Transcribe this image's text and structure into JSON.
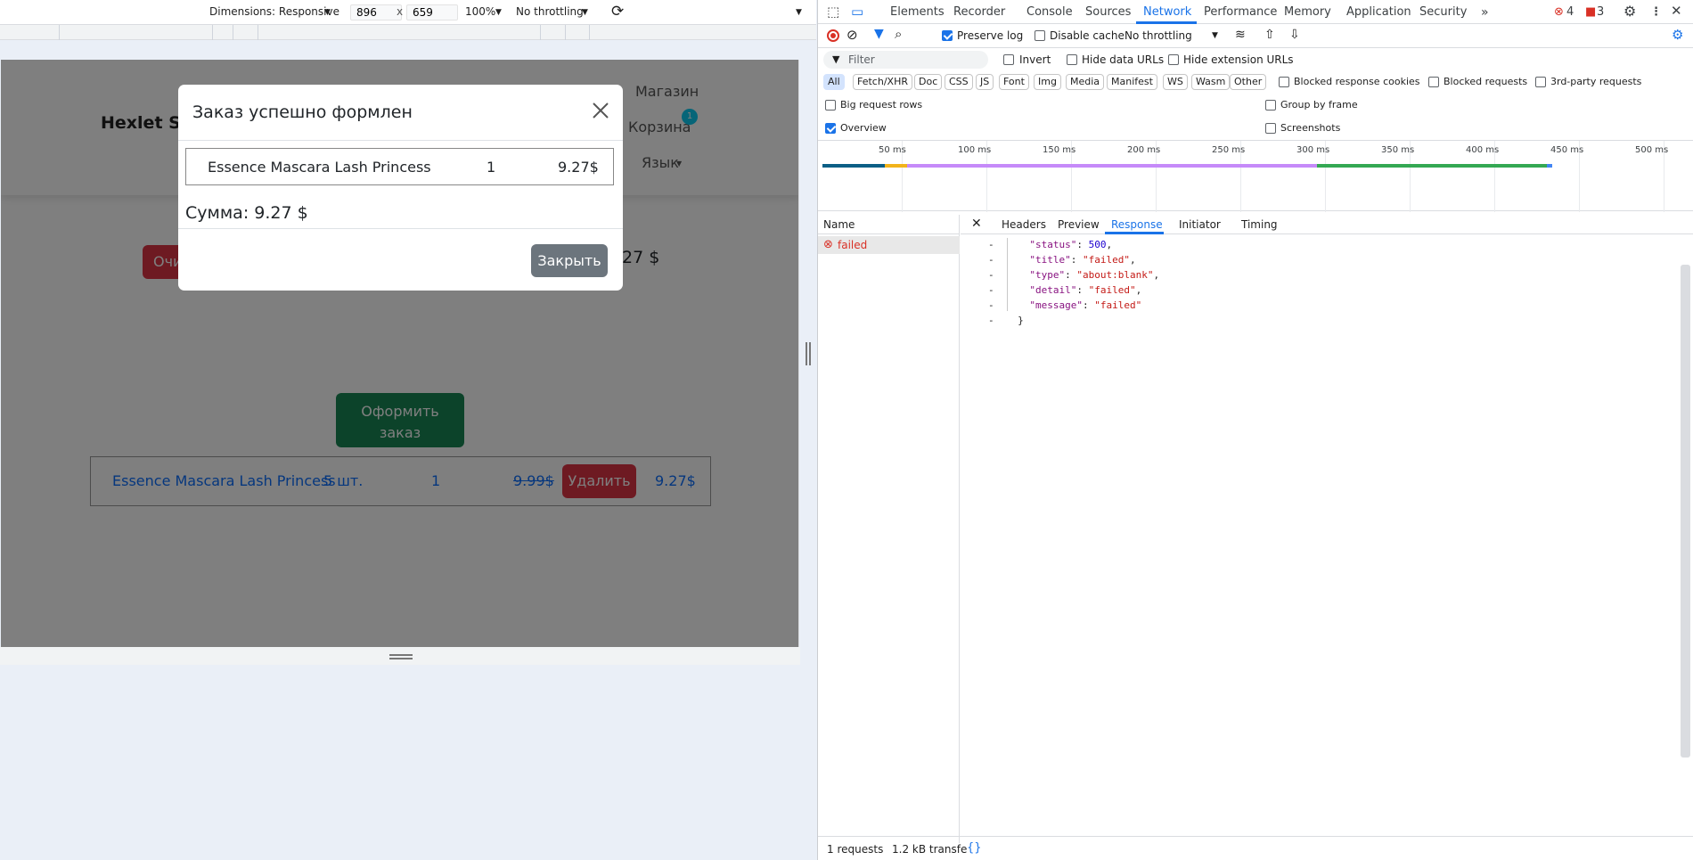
{
  "device_toolbar": {
    "dimensions_label": "Dimensions: Responsive",
    "width": "896",
    "x": "x",
    "height": "659",
    "zoom": "100%",
    "throttling": "No throttling"
  },
  "page": {
    "brand": "Hexlet Sto",
    "nav": {
      "shop": "Магазин",
      "cart": "Корзина",
      "cart_badge": "1",
      "language": "Язык"
    },
    "clear_button": "Очи",
    "total_partial": "27 $",
    "checkout_button_line1": "Оформить",
    "checkout_button_line2": "заказ",
    "cart_row": {
      "name": "Essence Mascara Lash Princess",
      "stock": "5 шт.",
      "qty": "1",
      "old_price": "9.99$",
      "delete_button": "Удалить",
      "price": "9.27$"
    }
  },
  "modal": {
    "title": "Заказ успешно формлен",
    "item_name": "Essence Mascara Lash Princess",
    "item_qty": "1",
    "item_price": "9.27$",
    "sum": "Сумма: 9.27 $",
    "close_button": "Закрыть"
  },
  "devtools": {
    "tabs": [
      "Elements",
      "Recorder",
      "Console",
      "Sources",
      "Network",
      "Performance",
      "Memory",
      "Application",
      "Security"
    ],
    "active_tab": "Network",
    "errors": "4",
    "warnings": "3",
    "preserve_log": "Preserve log",
    "disable_cache": "Disable cache",
    "throttling": "No throttling",
    "filter_placeholder": "Filter",
    "invert": "Invert",
    "hide_data_urls": "Hide data URLs",
    "hide_ext_urls": "Hide extension URLs",
    "type_filters": [
      "All",
      "Fetch/XHR",
      "Doc",
      "CSS",
      "JS",
      "Font",
      "Img",
      "Media",
      "Manifest",
      "WS",
      "Wasm",
      "Other"
    ],
    "blocked_cookies": "Blocked response cookies",
    "blocked_requests": "Blocked requests",
    "third_party": "3rd-party requests",
    "big_rows": "Big request rows",
    "group_by_frame": "Group by frame",
    "overview": "Overview",
    "screenshots": "Screenshots",
    "timeline_ticks": [
      "50 ms",
      "100 ms",
      "150 ms",
      "200 ms",
      "250 ms",
      "300 ms",
      "350 ms",
      "400 ms",
      "450 ms",
      "500 ms"
    ],
    "name_header": "Name",
    "request_name": "failed",
    "detail_tabs": [
      "Headers",
      "Preview",
      "Response",
      "Initiator",
      "Timing"
    ],
    "active_detail_tab": "Response",
    "response": {
      "status": "500",
      "title": "\"failed\"",
      "type": "\"about:blank\"",
      "detail": "\"failed\"",
      "message": "\"failed\""
    },
    "status_requests": "1 requests",
    "status_transfer": "1.2 kB transfe",
    "colors": {
      "accent": "#1a73e8",
      "error": "#d93025"
    }
  }
}
